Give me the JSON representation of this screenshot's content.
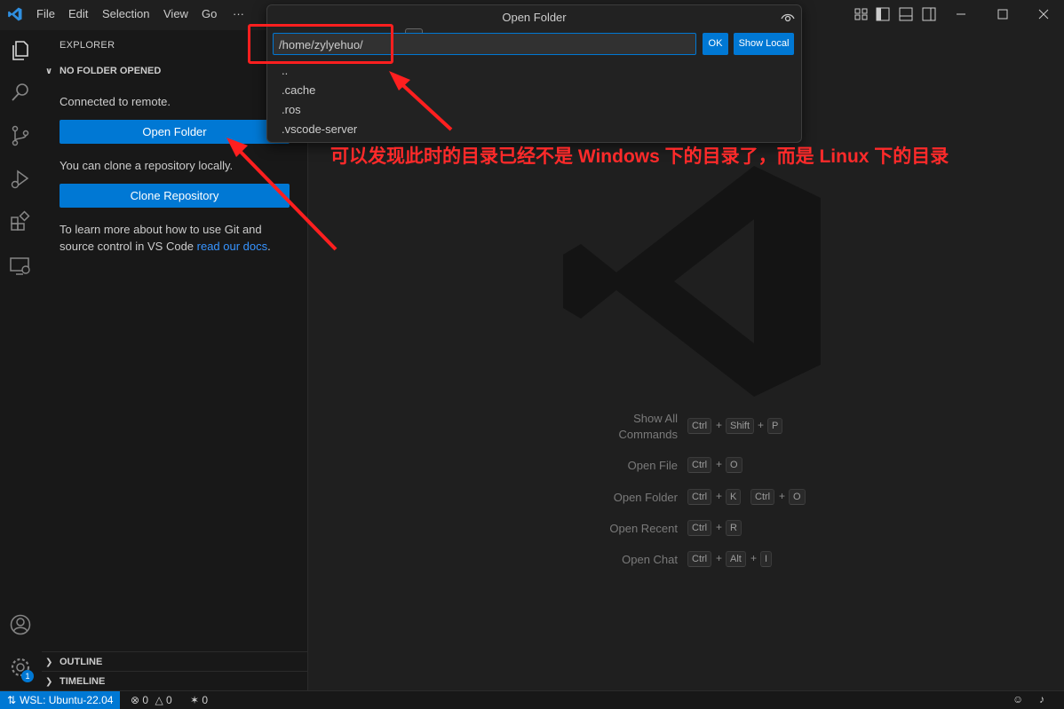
{
  "menu": [
    "File",
    "Edit",
    "Selection",
    "View",
    "Go",
    "···"
  ],
  "sidebar": {
    "header": "EXPLORER",
    "section": "NO FOLDER OPENED",
    "connected": "Connected to remote.",
    "open_folder_button": "Open Folder",
    "clone_text": "You can clone a repository locally.",
    "clone_button": "Clone Repository",
    "learn_line1": "To learn more about how to use Git and",
    "learn_line2": "source control in VS Code ",
    "learn_link": "read our docs",
    "learn_end": ".",
    "outline": "OUTLINE",
    "timeline": "TIMELINE"
  },
  "quick_open": {
    "title": "Open Folder",
    "path": "/home/zylyehuo/",
    "ok_button": "OK",
    "show_local_button": "Show Local",
    "items": [
      "..",
      ".cache",
      ".ros",
      ".vscode-server"
    ]
  },
  "shortcuts": [
    {
      "label1": "Show All",
      "label2": "Commands",
      "keys": [
        "Ctrl",
        "Shift",
        "P"
      ]
    },
    {
      "label1": "Open File",
      "keys": [
        "Ctrl",
        "O"
      ]
    },
    {
      "label1": "Open Folder",
      "keys": [
        "Ctrl",
        "K"
      ],
      "keys2": [
        "Ctrl",
        "O"
      ]
    },
    {
      "label1": "Open Recent",
      "keys": [
        "Ctrl",
        "R"
      ]
    },
    {
      "label1": "Open Chat",
      "keys": [
        "Ctrl",
        "Alt",
        "I"
      ]
    }
  ],
  "annotation": "可以发现此时的目录已经不是 Windows 下的目录了，而是 Linux 下的目录",
  "status": {
    "remote": "WSL: Ubuntu-22.04",
    "errors": "0",
    "warnings": "0",
    "ports": "0",
    "notification_badge": "1"
  },
  "colors": {
    "accent": "#0078d4",
    "annotation": "#ff2a2a"
  }
}
